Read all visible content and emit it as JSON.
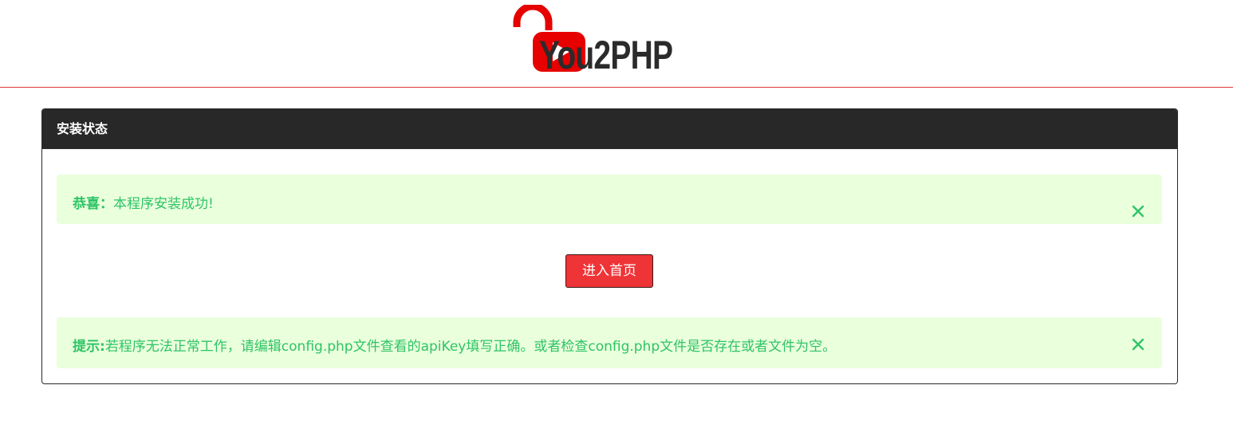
{
  "brand": {
    "logo_text": "You2PHP",
    "primary_color": "#e60000",
    "text_color": "#2b2b2b",
    "icon": "unlocked-padlock-play-icon"
  },
  "panel": {
    "title": "安装状态",
    "header_bg": "#282828"
  },
  "success_alert": {
    "strong": "恭喜：",
    "text": "本程序安装成功!",
    "bg": "#eaffdc",
    "color": "#2ec466",
    "close_icon": "close-icon"
  },
  "home_button": {
    "label": "进入首页",
    "bg": "#ee3437"
  },
  "tip_alert": {
    "strong": "提示:",
    "text": "若程序无法正常工作，请编辑config.php文件查看的apiKey填写正确。或者检查config.php文件是否存在或者文件为空。",
    "close_icon": "close-icon"
  }
}
